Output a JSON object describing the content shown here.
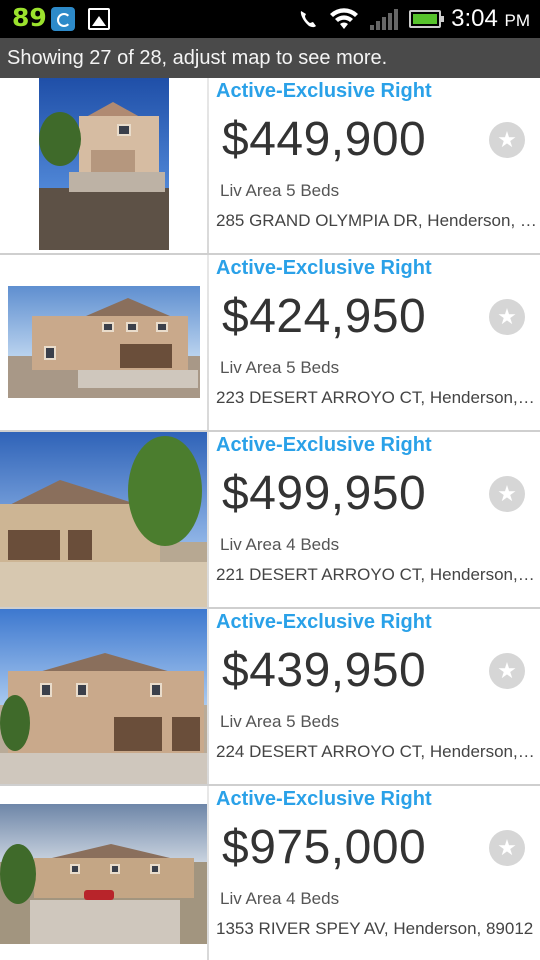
{
  "status_bar": {
    "notification_count": "89",
    "time": "3:04",
    "ampm": "PM"
  },
  "banner": {
    "text": "Showing 27 of 28, adjust map to see more."
  },
  "listings": [
    {
      "status": "Active-Exclusive Right",
      "price": "$449,900",
      "beds": "Liv Area 5 Beds",
      "address": "285 GRAND OLYMPIA DR, Henderson, 8..."
    },
    {
      "status": "Active-Exclusive Right",
      "price": "$424,950",
      "beds": "Liv Area 5 Beds",
      "address": "223 DESERT ARROYO CT, Henderson, 8..."
    },
    {
      "status": "Active-Exclusive Right",
      "price": "$499,950",
      "beds": "Liv Area 4 Beds",
      "address": "221 DESERT ARROYO CT, Henderson, 8..."
    },
    {
      "status": "Active-Exclusive Right",
      "price": "$439,950",
      "beds": "Liv Area 5 Beds",
      "address": "224 DESERT ARROYO CT, Henderson, 8..."
    },
    {
      "status": "Active-Exclusive Right",
      "price": "$975,000",
      "beds": "Liv Area 4 Beds",
      "address": "1353 RIVER SPEY AV, Henderson, 89012"
    }
  ],
  "colors": {
    "status_blue": "#2aa1e8",
    "battery_green": "#57c32c",
    "banner_bg": "#4a4a4a"
  }
}
